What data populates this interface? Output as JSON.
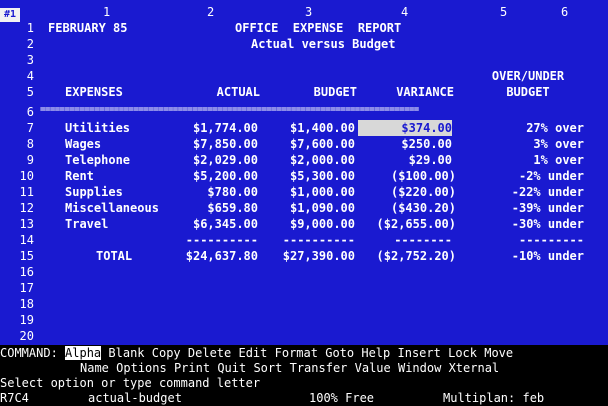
{
  "corner_label": "#1",
  "column_headers": [
    "1",
    "2",
    "3",
    "4",
    "5",
    "6"
  ],
  "row_numbers": [
    "1",
    "2",
    "3",
    "4",
    "5",
    "6",
    "7",
    "8",
    "9",
    "10",
    "11",
    "12",
    "13",
    "14",
    "15",
    "16",
    "17",
    "18",
    "19",
    "20"
  ],
  "title_cells": {
    "date": "FEBRUARY 85",
    "title": "OFFICE  EXPENSE  REPORT",
    "subtitle": "Actual versus Budget"
  },
  "header_rows": {
    "over_under_top": "OVER/UNDER",
    "expenses": "EXPENSES",
    "actual": "ACTUAL",
    "budget": "BUDGET",
    "variance": "VARIANCE",
    "over_under_bottom": "BUDGET"
  },
  "separator": "=============================================================================",
  "rows": [
    {
      "label": "Utilities",
      "actual": "$1,774.00",
      "budget": "$1,400.00",
      "variance": "$374.00",
      "pct": "27% over"
    },
    {
      "label": "Wages",
      "actual": "$7,850.00",
      "budget": "$7,600.00",
      "variance": "$250.00",
      "pct": "3% over"
    },
    {
      "label": "Telephone",
      "actual": "$2,029.00",
      "budget": "$2,000.00",
      "variance": "$29.00",
      "pct": "1% over"
    },
    {
      "label": "Rent",
      "actual": "$5,200.00",
      "budget": "$5,300.00",
      "variance": "($100.00)",
      "pct": "-2% under"
    },
    {
      "label": "Supplies",
      "actual": "$780.00",
      "budget": "$1,000.00",
      "variance": "($220.00)",
      "pct": "-22% under"
    },
    {
      "label": "Miscellaneous",
      "actual": "$659.80",
      "budget": "$1,090.00",
      "variance": "($430.20)",
      "pct": "-39% under"
    },
    {
      "label": "Travel",
      "actual": "$6,345.00",
      "budget": "$9,000.00",
      "variance": "($2,655.00)",
      "pct": "-30% under"
    }
  ],
  "dashes": {
    "actual": "----------",
    "budget": "----------",
    "variance": "--------",
    "pct": "---------"
  },
  "total": {
    "label": "TOTAL",
    "actual": "$24,637.80",
    "budget": "$27,390.00",
    "variance": "($2,752.20)",
    "pct": "-10% under"
  },
  "command": {
    "prefix": "COMMAND:",
    "items_line1": [
      "Alpha",
      "Blank",
      "Copy",
      "Delete",
      "Edit",
      "Format",
      "Goto",
      "Help",
      "Insert",
      "Lock",
      "Move"
    ],
    "items_line2": [
      "Name",
      "Options",
      "Print",
      "Quit",
      "Sort",
      "Transfer",
      "Value",
      "Window",
      "Xternal"
    ],
    "prompt": "Select option or type command letter",
    "cell_ref": "R7C4",
    "cell_contents": "actual-budget",
    "free": "100% Free",
    "file": "Multiplan: feb"
  },
  "colors": {
    "sheet_bg": "#1a1ad0",
    "text": "#ffffff",
    "command_bg": "#000000",
    "selected_cell": "#d8d8d8"
  }
}
